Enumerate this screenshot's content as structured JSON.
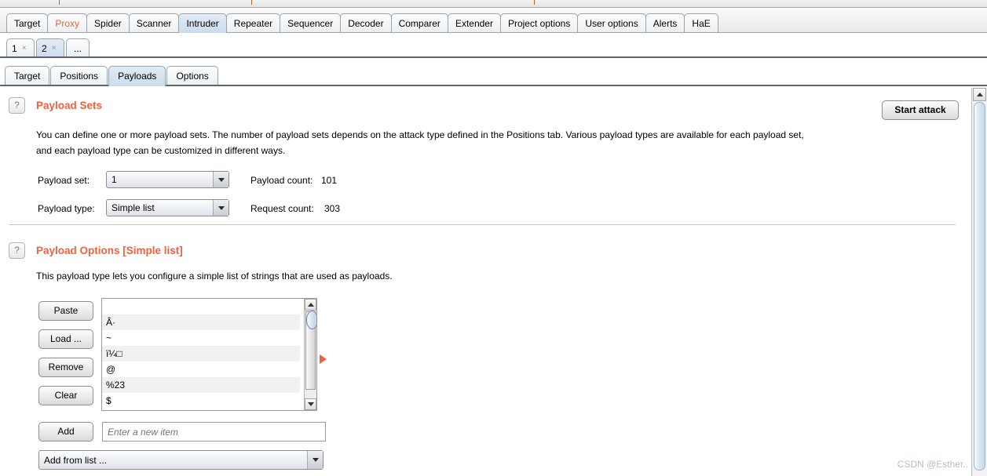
{
  "app": {
    "name": "Burp Suite Intruder"
  },
  "main_tabs": [
    {
      "label": "Target",
      "selected": false,
      "alert": false
    },
    {
      "label": "Proxy",
      "selected": false,
      "alert": true
    },
    {
      "label": "Spider",
      "selected": false,
      "alert": false
    },
    {
      "label": "Scanner",
      "selected": false,
      "alert": false
    },
    {
      "label": "Intruder",
      "selected": true,
      "alert": false
    },
    {
      "label": "Repeater",
      "selected": false,
      "alert": false
    },
    {
      "label": "Sequencer",
      "selected": false,
      "alert": false
    },
    {
      "label": "Decoder",
      "selected": false,
      "alert": false
    },
    {
      "label": "Comparer",
      "selected": false,
      "alert": false
    },
    {
      "label": "Extender",
      "selected": false,
      "alert": false
    },
    {
      "label": "Project options",
      "selected": false,
      "alert": false
    },
    {
      "label": "User options",
      "selected": false,
      "alert": false
    },
    {
      "label": "Alerts",
      "selected": false,
      "alert": false
    },
    {
      "label": "HaE",
      "selected": false,
      "alert": false
    }
  ],
  "attack_tabs": [
    {
      "label": "1",
      "close": "×",
      "selected": false
    },
    {
      "label": "2",
      "close": "×",
      "selected": true
    },
    {
      "label": "...",
      "close": "",
      "selected": false
    }
  ],
  "sub_tabs": [
    {
      "label": "Target",
      "selected": false
    },
    {
      "label": "Positions",
      "selected": false
    },
    {
      "label": "Payloads",
      "selected": true
    },
    {
      "label": "Options",
      "selected": false
    }
  ],
  "toolbar": {
    "start_attack_label": "Start attack"
  },
  "payload_sets": {
    "help_glyph": "?",
    "title": "Payload Sets",
    "description_line1": "You can define one or more payload sets. The number of payload sets depends on the attack type defined in the Positions tab. Various payload types are available for each payload set,",
    "description_line2": "and each payload type can be customized in different ways.",
    "payload_set_label": "Payload set:",
    "payload_set_value": "1",
    "payload_type_label": "Payload type:",
    "payload_type_value": "Simple list",
    "payload_count_label": "Payload count:",
    "payload_count_value": "101",
    "request_count_label": "Request count:",
    "request_count_value": "303"
  },
  "payload_options": {
    "help_glyph": "?",
    "title": "Payload Options [Simple list]",
    "description": "This payload type lets you configure a simple list of strings that are used as payloads.",
    "buttons": [
      {
        "label": "Paste"
      },
      {
        "label": "Load ..."
      },
      {
        "label": "Remove"
      },
      {
        "label": "Clear"
      }
    ],
    "list_items": [
      "",
      "Â·",
      "~",
      "ï¼□",
      "@",
      "%23",
      "$"
    ],
    "add_button_label": "Add",
    "add_input_placeholder": "Enter a new item",
    "add_input_value": "",
    "add_from_list_label": "Add from list ..."
  },
  "watermark": {
    "text": "CSDN @Esther.."
  },
  "colors": {
    "accent_orange": "#f4603a",
    "selected_tab_blue": "#cadcec",
    "scrollbar_blue": "#c3d9ea"
  }
}
